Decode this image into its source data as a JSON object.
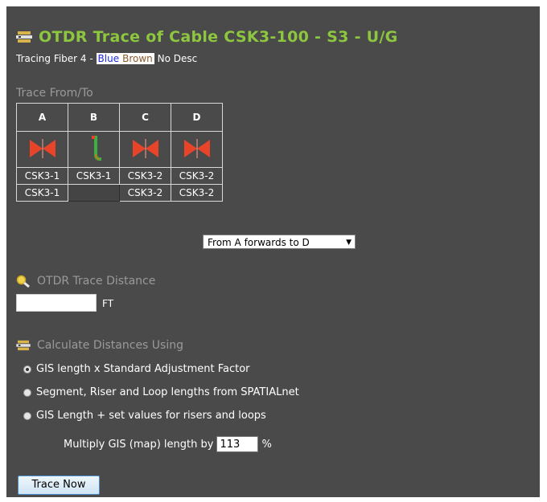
{
  "header": {
    "title": "OTDR Trace of Cable CSK3-100 - S3 - U/G",
    "subtitle_prefix": "Tracing Fiber 4 -",
    "chip_blue": "Blue",
    "chip_brown": "Brown",
    "subtitle_suffix": "No Desc"
  },
  "trace_table": {
    "section_label": "Trace From/To",
    "columns": [
      "A",
      "B",
      "C",
      "D"
    ],
    "icons": [
      "bowtie-icon",
      "slack-loop-icon",
      "bowtie-icon",
      "bowtie-icon"
    ],
    "row1": [
      "CSK3-1",
      "CSK3-1",
      "CSK3-2",
      "CSK3-2"
    ],
    "row2": [
      "CSK3-1",
      "",
      "CSK3-2",
      "CSK3-2"
    ]
  },
  "direction_select": {
    "value": "From A forwards to D"
  },
  "otdr": {
    "label": "OTDR Trace Distance",
    "value": "",
    "unit": "FT"
  },
  "calc": {
    "label": "Calculate Distances Using",
    "options": [
      {
        "label": "GIS length x Standard Adjustment Factor",
        "selected": true
      },
      {
        "label": "Segment, Riser and Loop lengths from SPATIALnet",
        "selected": false
      },
      {
        "label": "GIS Length + set values for risers and loops",
        "selected": false
      }
    ]
  },
  "multiply": {
    "label": "Multiply GIS (map) length by",
    "value": "113",
    "unit": "%"
  },
  "trace_button": {
    "label": "Trace Now"
  },
  "colors": {
    "panel_bg": "#4a4a4a",
    "title_green": "#8dc63f",
    "section_gray": "#9a9a9a",
    "bowtie_red": "#e8442a",
    "loop_green": "#3cb043"
  }
}
